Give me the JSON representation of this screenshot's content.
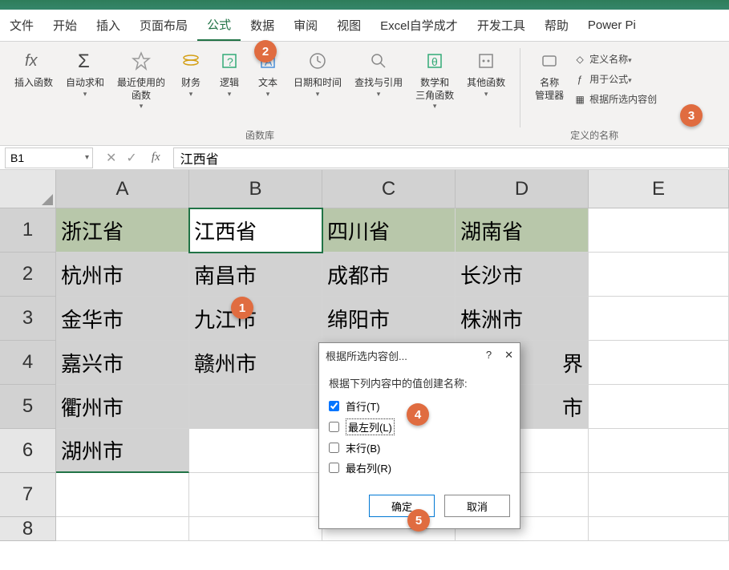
{
  "menubar": {
    "file": "文件",
    "home": "开始",
    "insert": "插入",
    "layout": "页面布局",
    "formulas": "公式",
    "data": "数据",
    "review": "审阅",
    "view": "视图",
    "custom1": "Excel自学成才",
    "dev": "开发工具",
    "help": "帮助",
    "powerpi": "Power Pi"
  },
  "ribbon": {
    "insert_fn": "插入函数",
    "autosum": "自动求和",
    "recent": "最近使用的\n函数",
    "financial": "财务",
    "logical": "逻辑",
    "text": "文本",
    "datetime": "日期和时间",
    "lookup": "查找与引用",
    "math": "数学和\n三角函数",
    "more": "其他函数",
    "group_lib": "函数库",
    "name_mgr": "名称\n管理器",
    "define_name": "定义名称",
    "use_in_formula": "用于公式",
    "create_from_sel": "根据所选内容创",
    "group_names": "定义的名称"
  },
  "fx": {
    "cell_ref": "B1",
    "value": "江西省"
  },
  "cols": [
    "A",
    "B",
    "C",
    "D",
    "E"
  ],
  "rows": [
    "1",
    "2",
    "3",
    "4",
    "5",
    "6",
    "7",
    "8"
  ],
  "cells": {
    "A1": "浙江省",
    "B1": "江西省",
    "C1": "四川省",
    "D1": "湖南省",
    "A2": "杭州市",
    "B2": "南昌市",
    "C2": "成都市",
    "D2": "长沙市",
    "A3": "金华市",
    "B3": "九江市",
    "C3": "绵阳市",
    "D3": "株洲市",
    "A4": "嘉兴市",
    "B4": "赣州市",
    "D4_suffix": "界",
    "A5": "衢州市",
    "D5_suffix": "市",
    "A6": "湖州市"
  },
  "dialog": {
    "title": "根据所选内容创...",
    "help": "?",
    "close": "✕",
    "prompt": "根据下列内容中的值创建名称:",
    "opt_top": "首行(T)",
    "opt_left": "最左列(L)",
    "opt_bottom": "末行(B)",
    "opt_right": "最右列(R)",
    "ok": "确定",
    "cancel": "取消"
  },
  "callouts": {
    "c1": "1",
    "c2": "2",
    "c3": "3",
    "c4": "4",
    "c5": "5"
  }
}
